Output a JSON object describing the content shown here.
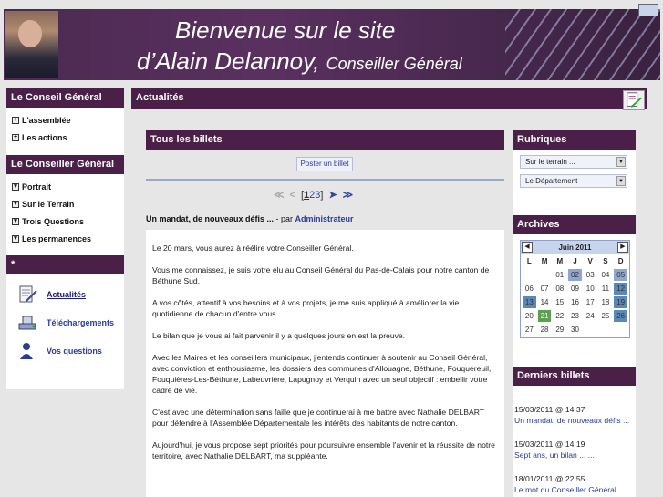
{
  "banner": {
    "line1": "Bienvenue sur le site",
    "line2": "d’Alain Delannoy,",
    "line2_small": "Conseiller Général"
  },
  "left": {
    "conseil_header": "Le Conseil Général",
    "conseil_items": [
      "L'assemblée",
      "Les actions"
    ],
    "conseiller_header": "Le Conseiller Général",
    "conseiller_items": [
      "Portrait",
      "Sur le Terrain",
      "Trois Questions",
      "Les permanences"
    ],
    "tools_header": "*",
    "tools": [
      "Actualités",
      "Téléchargements",
      "Vos questions"
    ]
  },
  "main": {
    "header": "Actualités",
    "section_title": "Tous les billets",
    "post_button": "Poster un billet",
    "pager": {
      "prefix": "[",
      "current": "1",
      "p2": "2",
      "p3": "3",
      "suffix": "]"
    },
    "post_title": "Un mandat, de nouveaux défis ...",
    "post_by": " - par ",
    "post_author": "Administrateur",
    "paragraphs": [
      "Le 20 mars, vous aurez à réélire votre Conseiller Général.",
      "Vous me connaissez, je suis votre élu au Conseil Général du Pas-de-Calais pour notre canton de Béthune Sud.",
      "A vos côtés, attentif à vos besoins et à vos projets, je me suis appliqué à améliorer la vie quotidienne de chacun d'entre vous.",
      "Le bilan que je vous ai fait parvenir il y a quelques jours en est la preuve.",
      "Avec les Maires et les conseillers municipaux, j'entends continuer à soutenir au Conseil Général, avec conviction et enthousiasme, les dossiers des communes d'Allouagne, Béthune, Fouquereuil, Fouquières-Les-Béthune, Labeuvrière, Lapugnoy et Verquin avec un seul objectif : embellir votre cadre de vie.",
      "C'est avec une détermination sans faille que je continuerai à me battre avec Nathalie DELBART pour défendre à l'Assemblée Départementale les intérêts des habitants de notre canton.",
      "Aujourd'hui, je vous propose sept priorités pour poursuivre ensemble l'avenir et la réussite de notre territoire, avec Nathalie DELBART, ma suppléante."
    ]
  },
  "right": {
    "rubriques_header": "Rubriques",
    "rubriques": [
      "Sur le terrain ...",
      "Le Département"
    ],
    "archives_header": "Archives",
    "calendar": {
      "month": "Juin 2011",
      "days": [
        "L",
        "M",
        "M",
        "J",
        "V",
        "S",
        "D"
      ],
      "cells": [
        "",
        "",
        "01",
        "02",
        "03",
        "04",
        "05",
        "06",
        "07",
        "08",
        "09",
        "10",
        "11",
        "12",
        "13",
        "14",
        "15",
        "16",
        "17",
        "18",
        "19",
        "20",
        "21",
        "22",
        "23",
        "24",
        "25",
        "26",
        "27",
        "28",
        "29",
        "30",
        "",
        "",
        ""
      ]
    },
    "derniers_header": "Derniers billets",
    "entries": [
      {
        "date": "15/03/2011 @ 14:37",
        "title": "Un mandat, de nouveaux défis ..."
      },
      {
        "date": "15/03/2011 @ 14:19",
        "title": "Sept ans, un bilan ... ..."
      },
      {
        "date": "18/01/2011 @ 22:55",
        "title": "Le mot du Conseiller Général"
      }
    ]
  }
}
